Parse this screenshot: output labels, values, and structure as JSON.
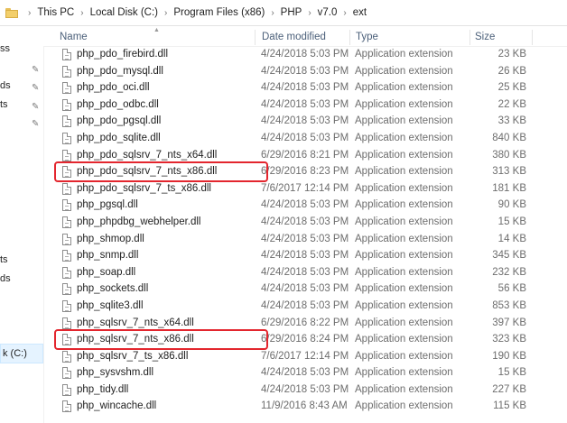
{
  "breadcrumb": [
    "This PC",
    "Local Disk (C:)",
    "Program Files (x86)",
    "PHP",
    "v7.0",
    "ext"
  ],
  "nav": {
    "fragments": [
      "ss",
      "ds",
      "ts",
      "ts",
      "ds"
    ],
    "selected_fragment": "k (C:)"
  },
  "columns": {
    "name": "Name",
    "date": "Date modified",
    "type": "Type",
    "size": "Size"
  },
  "files": [
    {
      "name": "php_pdo_firebird.dll",
      "date": "4/24/2018 5:03 PM",
      "type": "Application extension",
      "size": "23 KB"
    },
    {
      "name": "php_pdo_mysql.dll",
      "date": "4/24/2018 5:03 PM",
      "type": "Application extension",
      "size": "26 KB"
    },
    {
      "name": "php_pdo_oci.dll",
      "date": "4/24/2018 5:03 PM",
      "type": "Application extension",
      "size": "25 KB"
    },
    {
      "name": "php_pdo_odbc.dll",
      "date": "4/24/2018 5:03 PM",
      "type": "Application extension",
      "size": "22 KB"
    },
    {
      "name": "php_pdo_pgsql.dll",
      "date": "4/24/2018 5:03 PM",
      "type": "Application extension",
      "size": "33 KB"
    },
    {
      "name": "php_pdo_sqlite.dll",
      "date": "4/24/2018 5:03 PM",
      "type": "Application extension",
      "size": "840 KB"
    },
    {
      "name": "php_pdo_sqlsrv_7_nts_x64.dll",
      "date": "6/29/2016 8:21 PM",
      "type": "Application extension",
      "size": "380 KB"
    },
    {
      "name": "php_pdo_sqlsrv_7_nts_x86.dll",
      "date": "6/29/2016 8:23 PM",
      "type": "Application extension",
      "size": "313 KB"
    },
    {
      "name": "php_pdo_sqlsrv_7_ts_x86.dll",
      "date": "7/6/2017 12:14 PM",
      "type": "Application extension",
      "size": "181 KB"
    },
    {
      "name": "php_pgsql.dll",
      "date": "4/24/2018 5:03 PM",
      "type": "Application extension",
      "size": "90 KB"
    },
    {
      "name": "php_phpdbg_webhelper.dll",
      "date": "4/24/2018 5:03 PM",
      "type": "Application extension",
      "size": "15 KB"
    },
    {
      "name": "php_shmop.dll",
      "date": "4/24/2018 5:03 PM",
      "type": "Application extension",
      "size": "14 KB"
    },
    {
      "name": "php_snmp.dll",
      "date": "4/24/2018 5:03 PM",
      "type": "Application extension",
      "size": "345 KB"
    },
    {
      "name": "php_soap.dll",
      "date": "4/24/2018 5:03 PM",
      "type": "Application extension",
      "size": "232 KB"
    },
    {
      "name": "php_sockets.dll",
      "date": "4/24/2018 5:03 PM",
      "type": "Application extension",
      "size": "56 KB"
    },
    {
      "name": "php_sqlite3.dll",
      "date": "4/24/2018 5:03 PM",
      "type": "Application extension",
      "size": "853 KB"
    },
    {
      "name": "php_sqlsrv_7_nts_x64.dll",
      "date": "6/29/2016 8:22 PM",
      "type": "Application extension",
      "size": "397 KB"
    },
    {
      "name": "php_sqlsrv_7_nts_x86.dll",
      "date": "6/29/2016 8:24 PM",
      "type": "Application extension",
      "size": "323 KB"
    },
    {
      "name": "php_sqlsrv_7_ts_x86.dll",
      "date": "7/6/2017 12:14 PM",
      "type": "Application extension",
      "size": "190 KB"
    },
    {
      "name": "php_sysvshm.dll",
      "date": "4/24/2018 5:03 PM",
      "type": "Application extension",
      "size": "15 KB"
    },
    {
      "name": "php_tidy.dll",
      "date": "4/24/2018 5:03 PM",
      "type": "Application extension",
      "size": "227 KB"
    },
    {
      "name": "php_wincache.dll",
      "date": "11/9/2016 8:43 AM",
      "type": "Application extension",
      "size": "115 KB"
    }
  ],
  "highlight_color": "#e3262e"
}
